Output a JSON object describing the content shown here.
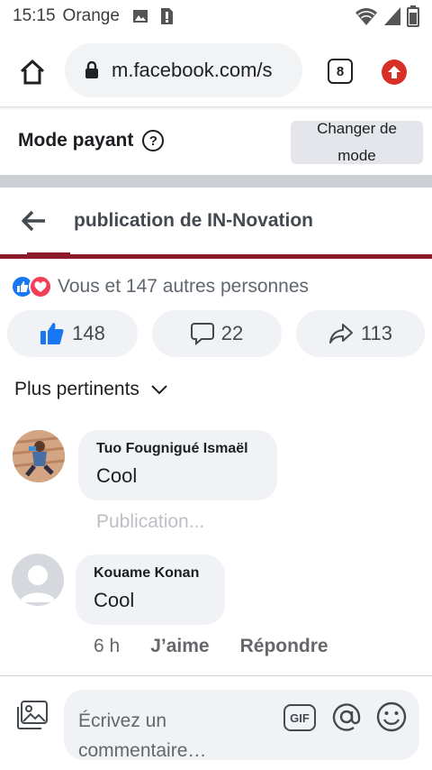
{
  "status_bar": {
    "time": "15:15",
    "carrier": "Orange"
  },
  "browser": {
    "url": "m.facebook.com/s",
    "tab_count": "8"
  },
  "mode_bar": {
    "title": "Mode payant",
    "help": "?",
    "change_button_line1": "Changer de",
    "change_button_line2": "mode"
  },
  "post_header": {
    "title": "publication de IN-Novation"
  },
  "reactions": {
    "summary": "Vous et 147 autres personnes"
  },
  "actions": {
    "likes": "148",
    "comments": "22",
    "shares": "113"
  },
  "sort": {
    "label": "Plus pertinents"
  },
  "comments": [
    {
      "author": "Tuo Fougnigué Ismaël",
      "text": "Cool",
      "status": "Publication..."
    },
    {
      "author": "Kouame Konan",
      "text": "Cool",
      "time": "6 h",
      "like_label": "J’aime",
      "reply_label": "Répondre"
    }
  ],
  "composer": {
    "placeholder": "Écrivez un commentaire…",
    "gif_label": "GIF"
  },
  "colors": {
    "facebook_blue": "#1877f2",
    "love_red": "#f33e58",
    "upgrade_red": "#d93025",
    "cover_strip": "#8b1a2a"
  }
}
